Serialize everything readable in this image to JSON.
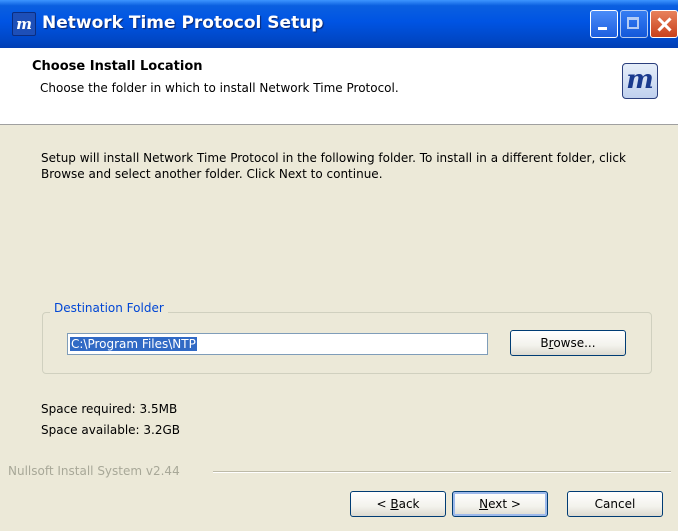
{
  "window": {
    "title": "Network Time Protocol Setup",
    "app_icon": "nsis-m-icon",
    "caption_buttons": [
      "minimize-icon",
      "maximize-icon",
      "close-icon"
    ]
  },
  "header": {
    "title": "Choose Install Location",
    "subtitle": "Choose the folder in which to install Network Time Protocol.",
    "logo_glyph": "m"
  },
  "body": {
    "instructions": "Setup will install Network Time Protocol in the following folder. To install in a different folder, click Browse and select another folder. Click Next to continue."
  },
  "destination": {
    "group_label": "Destination Folder",
    "path": "C:\\Program Files\\NTP",
    "browse_pre": "B",
    "browse_key": "r",
    "browse_post": "owse..."
  },
  "space": {
    "required": "Space required: 3.5MB",
    "available": "Space available: 3.2GB"
  },
  "footer": {
    "branding": "Nullsoft Install System v2.44",
    "back_pre": "< ",
    "back_key": "B",
    "back_post": "ack",
    "next_key": "N",
    "next_post": "ext >",
    "cancel_label": "Cancel"
  },
  "colors": {
    "titlebar": "#0054e3",
    "dialog_bg": "#ece9d8",
    "group_label": "#0046d5",
    "selection": "#316ac5"
  }
}
